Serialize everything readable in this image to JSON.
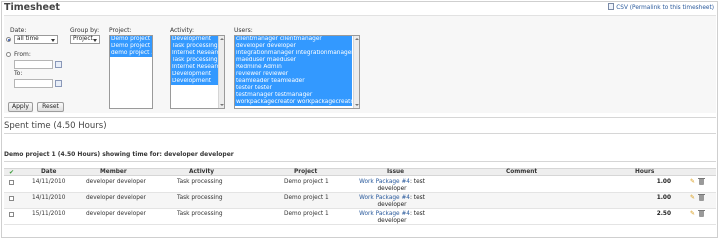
{
  "page": {
    "title": "Timesheet"
  },
  "csv": {
    "label": "CSV",
    "permalink": "(Permalink to this timesheet)"
  },
  "filters": {
    "date_label": "Date:",
    "date_value": "all time",
    "from_label": "From:",
    "to_label": "To:",
    "group_label": "Group by:",
    "group_value": "Project",
    "project_label": "Project:",
    "projects": [
      "Demo project 1",
      "Demo project 2",
      "demo project 3"
    ],
    "activity_label": "Activity:",
    "activities": [
      "Development",
      "Task processing",
      "Internet Research",
      "Task processing",
      "Internet Research",
      "Development",
      "Development"
    ],
    "users_label": "Users:",
    "users": [
      "clientmanager clientmanager",
      "developer developer",
      "integrationmanager integrationmanager",
      "maeduser maeduser",
      "Redmine Admin",
      "reviewer reviewer",
      "teamleader teamleader",
      "tester tester",
      "testmanager testmanager",
      "workpackagecreator workpackagecreator"
    ]
  },
  "buttons": {
    "apply": "Apply",
    "reset": "Reset"
  },
  "spent": {
    "title": "Spent time (4.50 Hours)"
  },
  "group": {
    "heading": "Demo project 1 (4.50 Hours) showing time for: developer developer"
  },
  "table": {
    "headers": {
      "check": "✔",
      "date": "Date",
      "member": "Member",
      "activity": "Activity",
      "project": "Project",
      "issue": "Issue",
      "comment": "Comment",
      "hours": "Hours"
    },
    "rows": [
      {
        "date": "14/11/2010",
        "member": "developer developer",
        "activity": "Task processing",
        "project": "Demo project 1",
        "issue_link": "Work Package #4",
        "issue_text": ": test",
        "issue_sub": "developer",
        "comment": "",
        "hours": "1.00"
      },
      {
        "date": "14/11/2010",
        "member": "developer developer",
        "activity": "Task processing",
        "project": "Demo project 1",
        "issue_link": "Work Package #4",
        "issue_text": ": test",
        "issue_sub": "developer",
        "comment": "",
        "hours": "1.00"
      },
      {
        "date": "15/11/2010",
        "member": "developer developer",
        "activity": "Task processing",
        "project": "Demo project 1",
        "issue_link": "Work Package #4",
        "issue_text": ": test",
        "issue_sub": "developer",
        "comment": "",
        "hours": "2.50"
      }
    ]
  }
}
